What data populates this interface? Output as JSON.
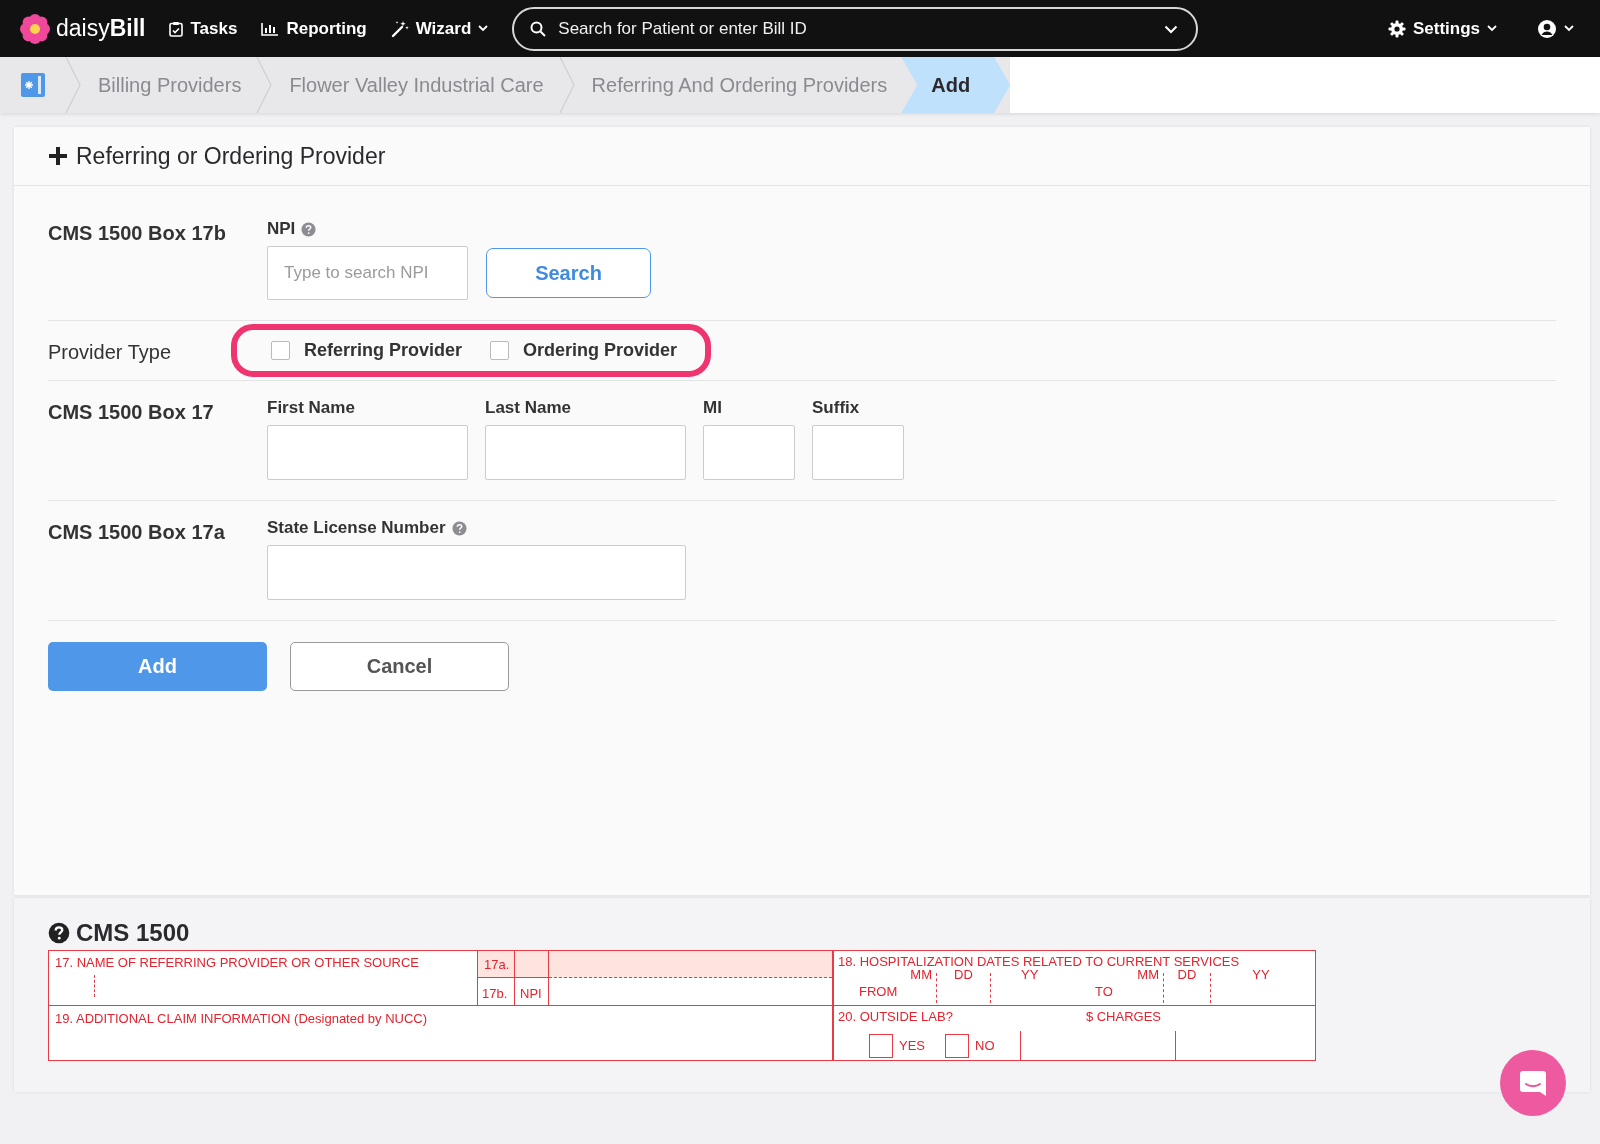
{
  "top_nav": {
    "logo": "daisy**Bill**",
    "items": [
      {
        "label": "Tasks",
        "kind": "tasks",
        "dropdown": false
      },
      {
        "label": "Reporting",
        "kind": "reporting",
        "dropdown": false
      },
      {
        "label": "Wizard",
        "kind": "wizard",
        "dropdown": true
      }
    ],
    "search": {
      "placeholder": "Search for Patient or enter Bill ID"
    },
    "settings": "Settings"
  },
  "breadcrumbs": [
    {
      "label": "Billing Providers",
      "selected": false
    },
    {
      "label": "Flower Valley Industrial Care",
      "selected": false
    },
    {
      "label": "Referring And Ordering Providers",
      "selected": false
    },
    {
      "label": "Add",
      "selected": true
    }
  ],
  "form": {
    "title": "Referring or Ordering Provider",
    "rows": [
      {
        "kind": "npi",
        "label": "CMS 1500 Box 17b",
        "field_label": "NPI",
        "placeholder": "Type to search NPI",
        "button": "Search"
      },
      {
        "kind": "checkboxes",
        "label": "Provider Type",
        "highlighted": true,
        "options": [
          {
            "label": "Referring Provider",
            "checked": false
          },
          {
            "label": "Ordering Provider",
            "checked": false
          }
        ]
      },
      {
        "kind": "fields",
        "label": "CMS 1500 Box 17",
        "fields": [
          {
            "label": "First Name",
            "kind": "wide",
            "help": false
          },
          {
            "label": "Last Name",
            "kind": "wide",
            "help": false
          },
          {
            "label": "MI",
            "kind": "narrow",
            "help": false
          },
          {
            "label": "Suffix",
            "kind": "narrow",
            "help": false
          }
        ]
      },
      {
        "kind": "fields",
        "label": "CMS 1500 Box 17a",
        "fields": [
          {
            "label": "State License Number",
            "kind": "long",
            "help": true
          }
        ]
      }
    ],
    "actions": [
      {
        "label": "Add",
        "kind": "primary"
      },
      {
        "label": "Cancel",
        "kind": "secondary"
      }
    ]
  },
  "reference": {
    "title": "CMS 1500",
    "box17": "17. NAME OF REFERRING PROVIDER OR OTHER SOURCE",
    "box17a": "17a.",
    "box17b": "17b.",
    "npi": "NPI",
    "box18": "18. HOSPITALIZATION DATES RELATED TO CURRENT SERVICES",
    "from_labels": [
      "MM",
      "DD",
      "YY"
    ],
    "from": "FROM",
    "to": "TO",
    "to_labels": [
      "MM",
      "DD",
      "YY"
    ],
    "box19": "19. ADDITIONAL CLAIM INFORMATION (Designated by NUCC)",
    "box20": "20. OUTSIDE LAB?",
    "charges": "$ CHARGES",
    "yes": "YES",
    "yes_checked": false,
    "no": "NO",
    "no_checked": false
  }
}
